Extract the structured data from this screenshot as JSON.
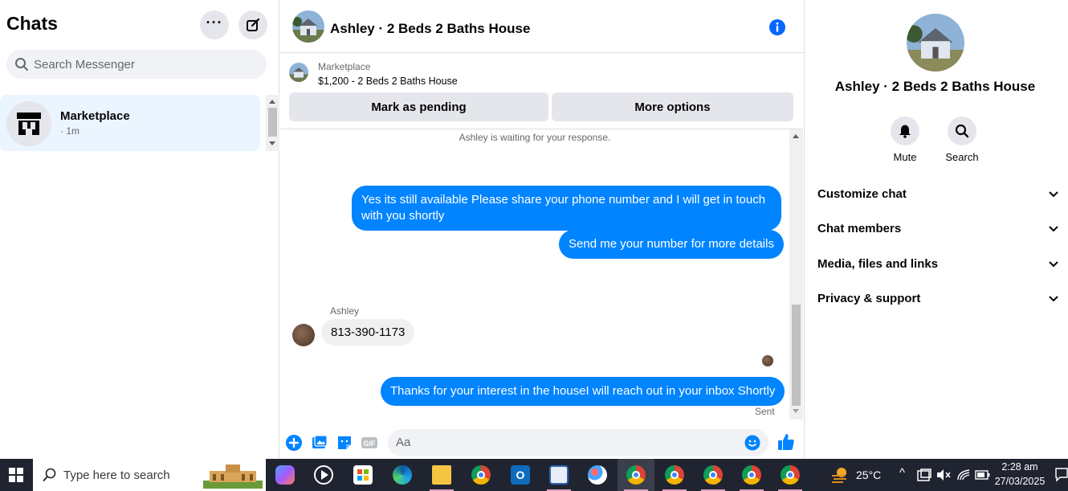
{
  "left": {
    "title": "Chats",
    "search_placeholder": "Search Messenger",
    "chats": [
      {
        "name": "Marketplace",
        "meta": "· 1m"
      }
    ]
  },
  "chat": {
    "title": "Ashley · 2 Beds 2 Baths House",
    "listing": {
      "source": "Marketplace",
      "price_title": "$1,200 - 2 Beds 2 Baths House",
      "pending_button": "Mark as pending",
      "options_button": "More options"
    },
    "waiting_note": "Ashley is waiting for your response.",
    "messages": [
      {
        "from": "me",
        "text": "Yes its still available Please share your phone number and I will get in touch with you shortly"
      },
      {
        "from": "me",
        "text": "Send me your number for more details"
      },
      {
        "from": "Ashley",
        "sender_label": "Ashley",
        "text": "813-390-1173"
      },
      {
        "from": "me",
        "text": "Thanks for your interest in the houseI will reach out in your inbox Shortly"
      }
    ],
    "sent_status": "Sent",
    "composer_placeholder": "Aa"
  },
  "right": {
    "name": "Ashley · 2 Beds 2 Baths House",
    "actions": [
      "Mute",
      "Search"
    ],
    "sections": [
      "Customize chat",
      "Chat members",
      "Media, files and links",
      "Privacy & support"
    ]
  },
  "taskbar": {
    "search_placeholder": "Type here to search",
    "temperature": "25°C",
    "time": "2:28 am",
    "date": "27/03/2025"
  },
  "colors": {
    "accent": "#0084ff",
    "info_blue": "#0866ff",
    "selected_chat_bg": "#ebf5ff"
  }
}
